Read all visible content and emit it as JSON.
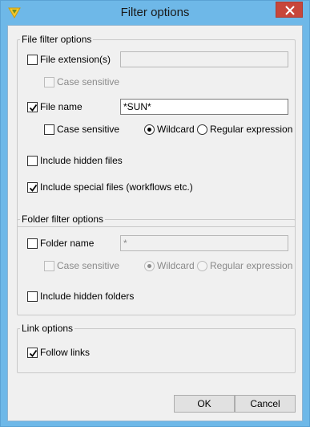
{
  "window": {
    "title": "Filter options"
  },
  "file_filter": {
    "title": "File filter options",
    "extension": {
      "label": "File extension(s)",
      "checked": false,
      "value": ""
    },
    "extension_case_sensitive": {
      "label": "Case sensitive",
      "checked": false,
      "enabled": false
    },
    "file_name": {
      "label": "File name",
      "checked": true,
      "value": "*SUN*"
    },
    "name_case_sensitive": {
      "label": "Case sensitive",
      "checked": false
    },
    "wildcard": {
      "label": "Wildcard",
      "selected": true
    },
    "regex": {
      "label": "Regular expression",
      "selected": false
    },
    "include_hidden": {
      "label": "Include hidden files",
      "checked": false
    },
    "include_special": {
      "label": "Include special files (workflows etc.)",
      "checked": true
    }
  },
  "folder_filter": {
    "title": "Folder filter options",
    "folder_name": {
      "label": "Folder name",
      "checked": false,
      "value": "*"
    },
    "case_sensitive": {
      "label": "Case sensitive",
      "checked": false,
      "enabled": false
    },
    "wildcard": {
      "label": "Wildcard",
      "selected": true,
      "enabled": false
    },
    "regex": {
      "label": "Regular expression",
      "selected": false,
      "enabled": false
    },
    "include_hidden": {
      "label": "Include hidden folders",
      "checked": false
    }
  },
  "link_options": {
    "title": "Link options",
    "follow_links": {
      "label": "Follow links",
      "checked": true
    }
  },
  "buttons": {
    "ok": "OK",
    "cancel": "Cancel"
  },
  "colors": {
    "titlebar": "#6eb8e8",
    "close": "#c7463a",
    "dialog_bg": "#f0f0f0"
  }
}
